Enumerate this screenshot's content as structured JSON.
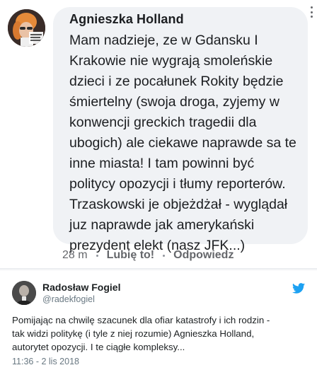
{
  "facebook_comment": {
    "author": "Agnieszka Holland",
    "text_lines": [
      "Mam nadzieje, ze w Gdansku I",
      "Krakowie nie wygrają smoleńskie",
      "dzieci i ze pocałunek Rokity będzie",
      "śmiertelny (swoja droga, zyjemy w",
      "konwencji greckich tragedii dla",
      "ubogich) ale ciekawe naprawde sa te",
      "inne miasta! I tam powinni być",
      "politycy opozycji i tłumy reporterów.",
      "Trzaskowski je objeżdżał - wyglądał",
      "juz naprawde jak amerykański",
      "prezydent elekt (nasz JFK...)"
    ],
    "timestamp": "28 m",
    "like_label": "Lubię to!",
    "reply_label": "Odpowiedz",
    "avatar_overlay_text": "WOLNE MEDIA DEMOKRACJA KONSTYTUCJA",
    "colors": {
      "bubble": "#f0f2f5",
      "text": "#1c1e21",
      "meta": "#65676b"
    }
  },
  "tweet": {
    "author_name": "Radosław Fogiel",
    "handle": "@radekfogiel",
    "text_lines": [
      "Pomijając na chwilę szacunek dla ofiar katastrofy i ich rodzin -",
      "tak widzi politykę (i tyle z niej rozumie) Agnieszka Holland,",
      "autorytet opozycji. I te ciągłe kompleksy..."
    ],
    "date": "11:36 - 2 lis 2018",
    "icon": "twitter-bird-icon",
    "colors": {
      "bird": "#1da1f2",
      "text": "#1c2022",
      "meta": "#697882"
    }
  }
}
